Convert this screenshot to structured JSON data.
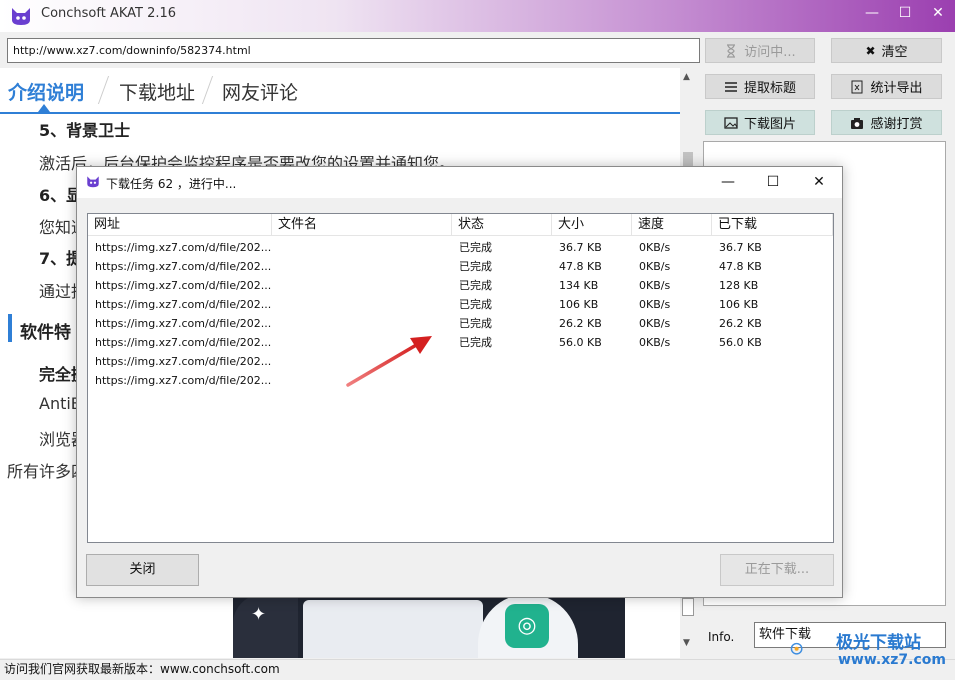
{
  "window": {
    "title": "Conchsoft AKAT 2.16",
    "minimize": "—",
    "maximize": "☐",
    "close": "✕"
  },
  "url_bar": {
    "value": "http://www.xz7.com/downinfo/582374.html"
  },
  "buttons": {
    "visiting": "访问中...",
    "clear": "清空",
    "extract_title": "提取标题",
    "export_stats": "统计导出",
    "download_images": "下载图片",
    "donate": "感谢打赏"
  },
  "article": {
    "tabs": [
      {
        "label": "介绍说明",
        "active": true
      },
      {
        "label": "下载地址",
        "active": false
      },
      {
        "label": "网友评论",
        "active": false
      }
    ],
    "lines": {
      "h5": "5、背景卫士",
      "p5": "激活后，后台保护会监控程序是否要改您的设置并通知您。",
      "h6": "6、显",
      "p6": "您知道",
      "h7": "7、提",
      "p7": "通过拐",
      "section": "软件特",
      "s1": "完全摄",
      "s2": "AntiB",
      "s3": "浏览器",
      "s4": "所有许多四"
    }
  },
  "info": {
    "label": "Info.",
    "value": "软件下载"
  },
  "status_bar": {
    "text": "访问我们官网获取最新版本：www.conchsoft.com"
  },
  "watermark": {
    "name": "极光下载站",
    "url": "www.xz7.com"
  },
  "dialog": {
    "title": "下载任务 62 ，进行中...",
    "columns": [
      "网址",
      "文件名",
      "状态",
      "大小",
      "速度",
      "已下载"
    ],
    "rows": [
      {
        "url": "https://img.xz7.com/d/file/202...",
        "filename": "",
        "status": "已完成",
        "size": "36.7 KB",
        "speed": "0KB/s",
        "downloaded": "36.7 KB"
      },
      {
        "url": "https://img.xz7.com/d/file/202...",
        "filename": "",
        "status": "已完成",
        "size": "47.8 KB",
        "speed": "0KB/s",
        "downloaded": "47.8 KB"
      },
      {
        "url": "https://img.xz7.com/d/file/202...",
        "filename": "",
        "status": "已完成",
        "size": "134 KB",
        "speed": "0KB/s",
        "downloaded": "128 KB"
      },
      {
        "url": "https://img.xz7.com/d/file/202...",
        "filename": "",
        "status": "已完成",
        "size": "106 KB",
        "speed": "0KB/s",
        "downloaded": "106 KB"
      },
      {
        "url": "https://img.xz7.com/d/file/202...",
        "filename": "",
        "status": "已完成",
        "size": "26.2 KB",
        "speed": "0KB/s",
        "downloaded": "26.2 KB"
      },
      {
        "url": "https://img.xz7.com/d/file/202...",
        "filename": "",
        "status": "已完成",
        "size": "56.0 KB",
        "speed": "0KB/s",
        "downloaded": "56.0 KB"
      },
      {
        "url": "https://img.xz7.com/d/file/202...",
        "filename": "",
        "status": "",
        "size": "",
        "speed": "",
        "downloaded": ""
      },
      {
        "url": "https://img.xz7.com/d/file/202...",
        "filename": "",
        "status": "",
        "size": "",
        "speed": "",
        "downloaded": ""
      }
    ],
    "close_button": "关闭",
    "downloading_button": "正在下载..."
  },
  "colors": {
    "accent": "#2f7fd6",
    "titlebar_end": "#9b3fb0",
    "arrow": "#d42020"
  }
}
